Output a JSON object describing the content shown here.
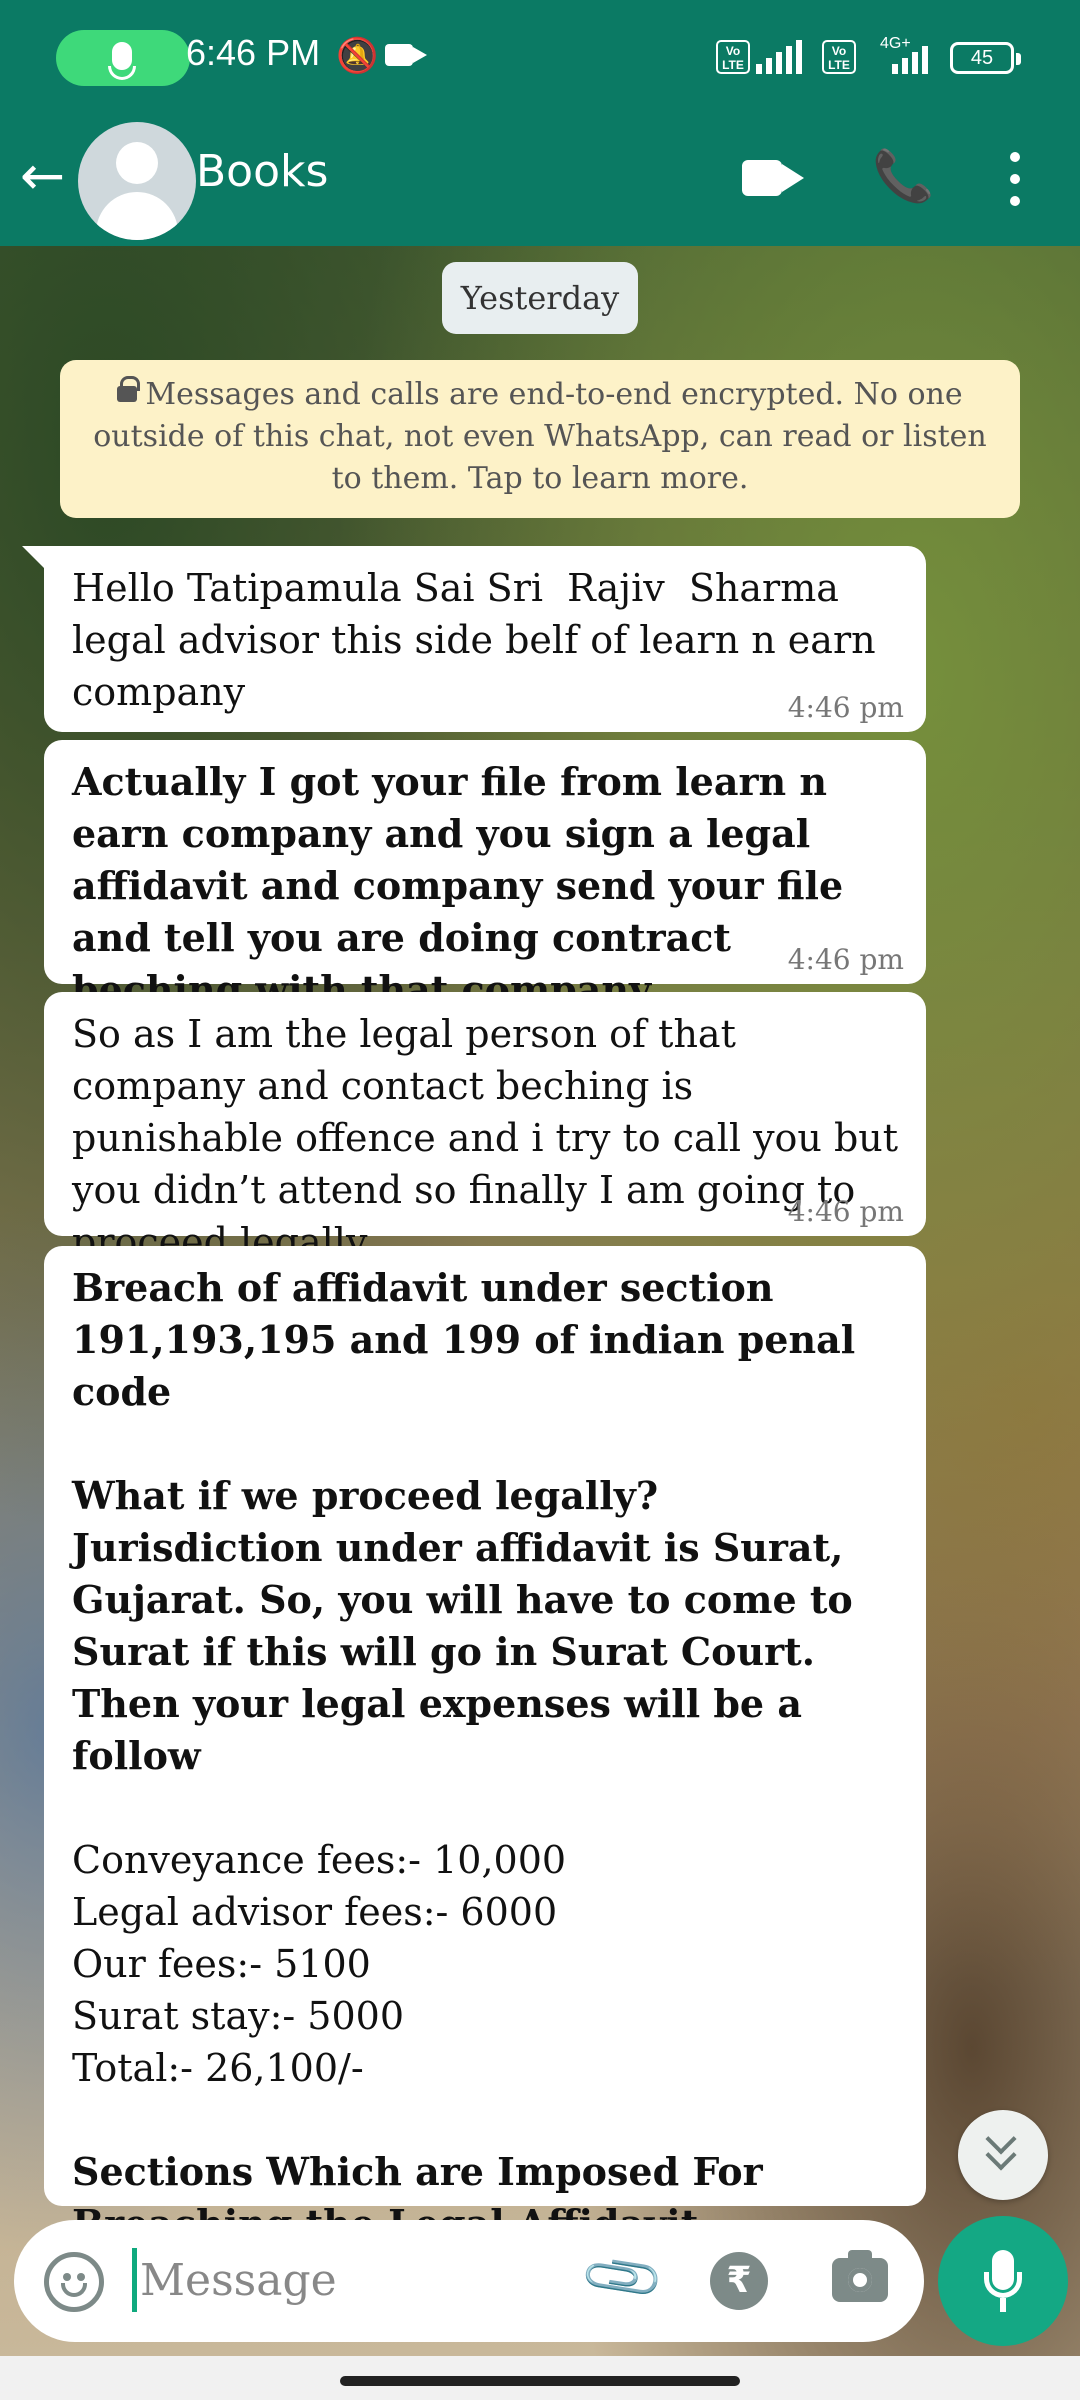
{
  "status_bar": {
    "time": "6:46 PM",
    "volte1": "Vo LTE",
    "volte2": "Vo LTE",
    "network": "4G+",
    "battery": "45"
  },
  "header": {
    "contact_name": "Books"
  },
  "chat": {
    "date_chip": "Yesterday",
    "encryption_notice": "Messages and calls are end-to-end encrypted. No one outside of this chat, not even WhatsApp, can read or listen to them. Tap to learn more.",
    "messages": [
      {
        "text": "Hello Tatipamula Sai Sri  Rajiv  Sharma legal advisor this side belf of learn n earn company",
        "time": "4:46 pm"
      },
      {
        "text": "Actually I got your file from learn n earn company and you sign a legal affidavit and company send your file and tell you are doing contract beching with that company",
        "time": "4:46 pm"
      },
      {
        "text": "So as I am the legal person of that company and contact beching is punishable offence and i try to call you but you didn’t attend so finally I am going to proceed legally",
        "time": "4:46 pm"
      },
      {
        "line1": "Breach of affidavit under section 191,193,195 and 199 of indian penal code",
        "line2": "What if we proceed legally?",
        "line3": "Jurisdiction under affidavit is Surat, Gujarat. So, you will have to come to Surat if this will go in Surat Court. Then your legal expenses will be a follow",
        "fees": [
          "Conveyance fees:- 10,000",
          "Legal advisor fees:- 6000",
          "Our fees:- 5100",
          "Surat stay:- 5000",
          "Total:- 26,100/-"
        ],
        "line4": "Sections Which are Imposed For Breaching the Legal Affidavit"
      }
    ]
  },
  "composer": {
    "placeholder": "Message",
    "rupee_symbol": "₹"
  },
  "colors": {
    "header_green": "#0b7a64",
    "mic_button": "#14a884",
    "encryption_bg": "#fdf2c8"
  }
}
